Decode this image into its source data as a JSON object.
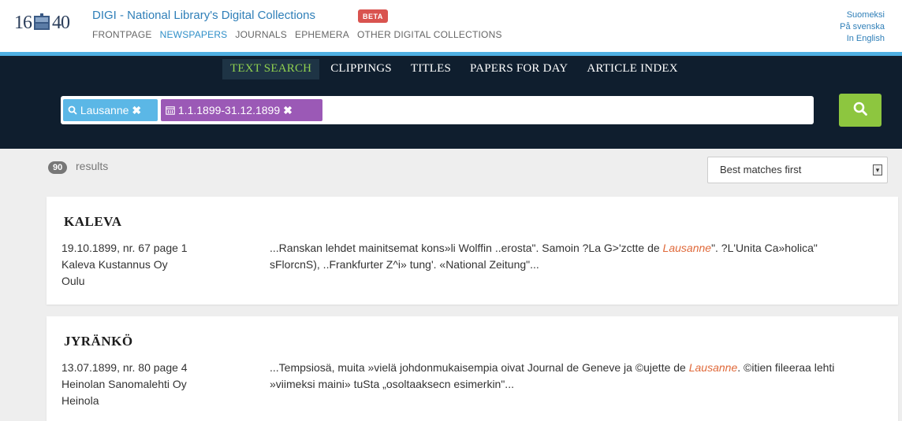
{
  "header": {
    "logo_left": "16",
    "logo_right": "40",
    "site_title": "DIGI - National Library's Digital Collections",
    "beta": "BETA",
    "nav": [
      "FRONTPAGE",
      "NEWSPAPERS",
      "JOURNALS",
      "EPHEMERA",
      "OTHER DIGITAL COLLECTIONS"
    ],
    "active_nav": "NEWSPAPERS",
    "languages": [
      "Suomeksi",
      "På svenska",
      "In English"
    ]
  },
  "tabs": [
    "TEXT SEARCH",
    "CLIPPINGS",
    "TITLES",
    "PAPERS FOR DAY",
    "ARTICLE INDEX"
  ],
  "active_tab": "TEXT SEARCH",
  "search": {
    "query_chip": "Lausanne",
    "date_chip": "1.1.1899-31.12.1899",
    "remove_icon": "close-icon"
  },
  "results": {
    "count": "90",
    "label": "results",
    "sort_selected": "Best matches first"
  },
  "items": [
    {
      "title": "KALEVA",
      "date_issue": "19.10.1899, nr. 67 page 1",
      "publisher": "Kaleva Kustannus Oy",
      "place": "Oulu",
      "snippet_pre": "...Ranskan lehdet mainitsemat kons»li Wolffin ..erosta\". Samoin ?La G>'zctte de ",
      "snippet_hit": "Lausanne",
      "snippet_post": "\". ?L'Unita Ca»holica\" sFlorcnS), ..Frankfurter Z^i» tung'. «National Zeitung\"..."
    },
    {
      "title": "JYRÄNKÖ",
      "date_issue": "13.07.1899, nr. 80 page 4",
      "publisher": "Heinolan Sanomalehti Oy",
      "place": "Heinola",
      "snippet_pre": "...Tempsiosä, muita »vielä johdonmukaisempia oivat Journal de Geneve ja ©ujette de ",
      "snippet_hit": "Lausanne",
      "snippet_post": ". ©itien fileeraa lehti »viimeksi maini» tuSta „osoltaaksecn esimerkin\"..."
    }
  ],
  "colors": {
    "accent_blue": "#4fb0e3",
    "dark_bg": "#0f1e2e",
    "search_green": "#8dc63f",
    "query_chip": "#5bb7e6",
    "date_chip": "#9b59b6",
    "highlight": "#e0693a"
  }
}
